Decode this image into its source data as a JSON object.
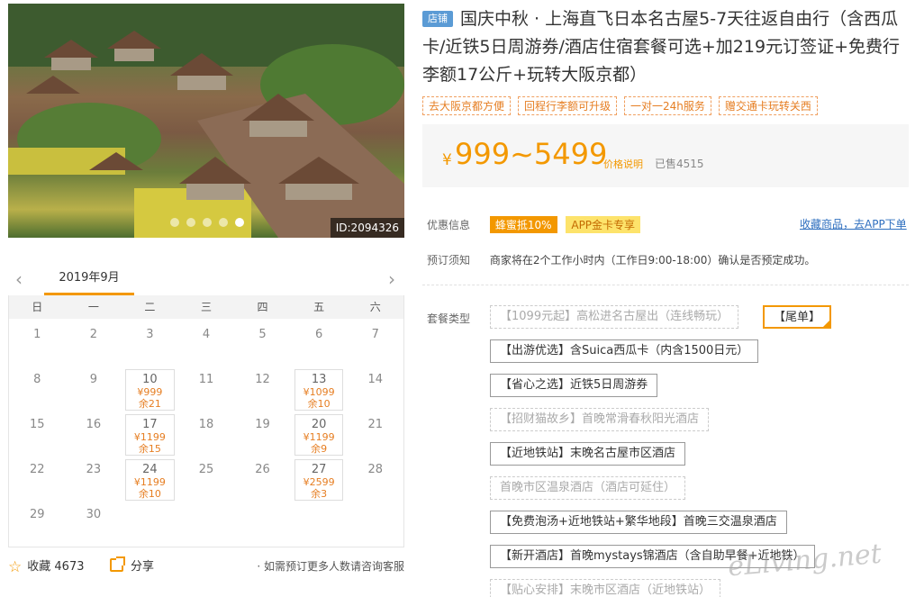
{
  "photo": {
    "id_label": "ID:2094326",
    "dot_count": 5,
    "active_dot": 4
  },
  "calendar": {
    "prev_icon": "chevron-left-icon",
    "next_icon": "chevron-right-icon",
    "month": "2019年9月",
    "weekdays": [
      "日",
      "一",
      "二",
      "三",
      "四",
      "五",
      "六"
    ],
    "days": [
      {
        "d": "1"
      },
      {
        "d": "2"
      },
      {
        "d": "3"
      },
      {
        "d": "4"
      },
      {
        "d": "5"
      },
      {
        "d": "6"
      },
      {
        "d": "7"
      },
      {
        "d": "8"
      },
      {
        "d": "9"
      },
      {
        "d": "10",
        "price": "¥999",
        "remain": "余21"
      },
      {
        "d": "11"
      },
      {
        "d": "12"
      },
      {
        "d": "13",
        "price": "¥1099",
        "remain": "余10"
      },
      {
        "d": "14"
      },
      {
        "d": "15"
      },
      {
        "d": "16"
      },
      {
        "d": "17",
        "price": "¥1199",
        "remain": "余15"
      },
      {
        "d": "18"
      },
      {
        "d": "19"
      },
      {
        "d": "20",
        "price": "¥1199",
        "remain": "余9"
      },
      {
        "d": "21"
      },
      {
        "d": "22"
      },
      {
        "d": "23"
      },
      {
        "d": "24",
        "price": "¥1199",
        "remain": "余10"
      },
      {
        "d": "25"
      },
      {
        "d": "26"
      },
      {
        "d": "27",
        "price": "¥2599",
        "remain": "余3"
      },
      {
        "d": "28"
      },
      {
        "d": "29"
      },
      {
        "d": "30"
      }
    ]
  },
  "footer": {
    "fav_label": "收藏",
    "fav_count": "4673",
    "share_label": "分享",
    "hint": "· 如需预订更多人数请咨询客服"
  },
  "product": {
    "shop_badge": "店铺",
    "title": "国庆中秋 · 上海直飞日本名古屋5-7天往返自由行（含西瓜卡/近铁5日周游券/酒店住宿套餐可选+加219元订签证+免费行李额17公斤+玩转大阪京都）",
    "tags": [
      "去大阪京都方便",
      "回程行李额可升级",
      "一对一24h服务",
      "赠交通卡玩转关西"
    ],
    "currency": "¥",
    "price": "999~5499",
    "price_explain": "价格说明",
    "sold": "已售4515"
  },
  "offers": {
    "label": "优惠信息",
    "promo1": "蜂蜜抵10%",
    "promo2": "APP金卡专享",
    "fav_link": "收藏商品，去APP下单"
  },
  "notice": {
    "label": "预订须知",
    "text": "商家将在2个工作小时内（工作日9:00-18:00）确认是否预定成功。"
  },
  "packages": {
    "label": "套餐类型",
    "options": [
      {
        "text": "【1099元起】高松进名古屋出（连线畅玩）",
        "state": "disabled"
      },
      {
        "text": "【尾单】",
        "state": "selected"
      },
      {
        "text": "【出游优选】含Suica西瓜卡（内含1500日元）",
        "state": "normal"
      },
      {
        "text": "【省心之选】近铁5日周游券",
        "state": "normal"
      },
      {
        "text": "【招财猫故乡】首晚常滑春秋阳光酒店",
        "state": "disabled"
      },
      {
        "text": "【近地铁站】末晚名古屋市区酒店",
        "state": "normal"
      },
      {
        "text": "首晚市区温泉酒店（酒店可延住）",
        "state": "disabled"
      },
      {
        "text": "【免费泡汤+近地铁站+繁华地段】首晚三交温泉酒店",
        "state": "normal"
      },
      {
        "text": "【新开酒店】首晚mystays锦酒店（含自助早餐+近地铁）",
        "state": "normal"
      },
      {
        "text": "【贴心安排】末晚市区酒店（近地铁站）",
        "state": "disabled"
      }
    ]
  },
  "watermark": "eLiving.net"
}
